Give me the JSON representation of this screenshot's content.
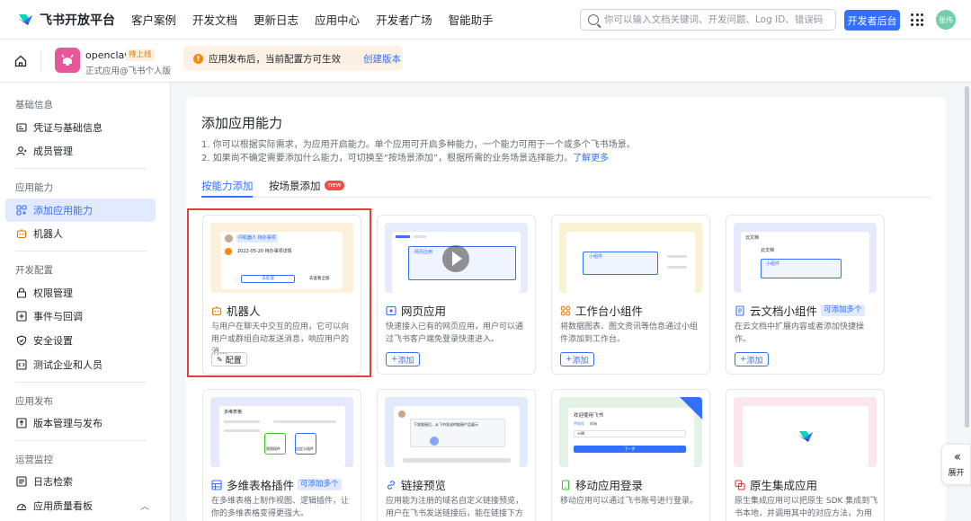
{
  "brand": {
    "name": "飞书开放平台"
  },
  "nav": [
    "客户案例",
    "开发文档",
    "更新日志",
    "应用中心",
    "开发者广场",
    "智能助手"
  ],
  "search": {
    "placeholder": "你可以输入文档关键词、开发问题、Log ID、错误码"
  },
  "header": {
    "dev_console": "开发者后台",
    "avatar_text": "张伟"
  },
  "app": {
    "name": "openclaw",
    "status": "待上线",
    "subtitle": "正式应用@飞书个人版"
  },
  "notice": {
    "text": "应用发布后，当前配置方可生效",
    "link": "创建版本"
  },
  "sidebar": {
    "sections": [
      {
        "title": "基础信息",
        "items": [
          "凭证与基础信息",
          "成员管理"
        ]
      },
      {
        "title": "应用能力",
        "items": [
          "添加应用能力",
          "机器人"
        ]
      },
      {
        "title": "开发配置",
        "items": [
          "权限管理",
          "事件与回调",
          "安全设置",
          "测试企业和人员"
        ]
      },
      {
        "title": "应用发布",
        "items": [
          "版本管理与发布"
        ]
      },
      {
        "title": "运营监控",
        "items": [
          "日志检索",
          "应用质量看板"
        ]
      }
    ],
    "active": "添加应用能力"
  },
  "main": {
    "title": "添加应用能力",
    "desc1": "1. 你可以根据实际需求，为应用开启能力。单个应用可开启多种能力，一个能力可用于一个或多个飞书场景。",
    "desc2": "2. 如果尚不确定需要添加什么能力，可切换至“按场景添加”，根据所需的业务场景选择能力。",
    "desc2_link": "了解更多",
    "tabs": [
      "按能力添加",
      "按场景添加"
    ],
    "tab_badge": "new",
    "cards": [
      {
        "title": "机器人",
        "desc": "与用户在聊天中交互的应用，它可以向用户或群组自动发送消息，响应用户的消...",
        "button": "配置",
        "icon": "robot-icon",
        "bg": "#fdf0dc"
      },
      {
        "title": "网页应用",
        "desc": "快速接入已有的网页应用，用户可以通过飞书客户端免登录快速进入。",
        "button": "添加",
        "icon": "web-app-icon",
        "bg": "#e6ebfd"
      },
      {
        "title": "工作台小组件",
        "desc": "将数据图表、图文资讯等信息通过小组件添加到工作台。",
        "button": "添加",
        "icon": "widget-icon",
        "bg": "#fbf2d4"
      },
      {
        "title": "云文档小组件",
        "tag": "可添加多个",
        "desc": "在云文档中扩展内容或者添加快捷操作。",
        "button": "添加",
        "icon": "doc-icon",
        "bg": "#e6e9fb"
      },
      {
        "title": "多维表格插件",
        "tag": "可添加多个",
        "desc": "在多维表格上制作视图、逻辑插件，让你的多维表格变得更强大。",
        "icon": "bitable-icon",
        "bg": "#e6e8fb"
      },
      {
        "title": "链接预览",
        "desc": "应用能为注册的域名自定义链接预览，用户在飞书发送链接后，能在链接下方展示...",
        "icon": "link-icon",
        "bg": "#e2ebfb"
      },
      {
        "title": "移动应用登录",
        "desc": "移动应用可以通过飞书账号进行登录。",
        "icon": "mobile-icon",
        "bg": "#e2f3e6"
      },
      {
        "title": "原生集成应用",
        "desc": "原生集成应用可以把原生 SDK 集成到飞书本地，并调用其中的对应方法，为用户提...",
        "icon": "native-icon",
        "bg": "#fbe6ee"
      }
    ]
  },
  "previews": {
    "bot_chip": "问机器人 待办事项",
    "bot_date": "2022-05-20 待办事项详情",
    "bot_btn1": "去处理",
    "bot_btn2": "去查看全部",
    "web_tabs": [
      "网页应用"
    ],
    "widget_label": "小组件",
    "doc_title": "云文档",
    "doc_sub": "云文档",
    "doc_block": "小组件",
    "bitable_title": "多维表格",
    "bitable_plugin1": "视图插件",
    "bitable_plugin2": "自定义插件",
    "link_chat": "下发链接后，从飞书发送的链接产品展示",
    "mobile_title": "欢迎使用飞书",
    "mobile_tabs": [
      "手机号",
      "邮箱"
    ],
    "mobile_code": "+86",
    "mobile_btn": "下一步"
  },
  "expand": {
    "label": "展开"
  }
}
